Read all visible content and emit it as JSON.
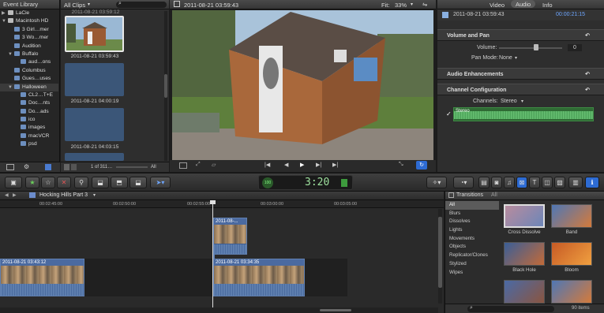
{
  "library": {
    "title": "Event Library",
    "items": [
      {
        "label": "LaCie",
        "kind": "drive",
        "indent": 0,
        "expanded": false
      },
      {
        "label": "Macintosh HD",
        "kind": "drive",
        "indent": 0,
        "expanded": true
      },
      {
        "label": "3 Girl…mer",
        "kind": "event",
        "indent": 1
      },
      {
        "label": "3 Wo…mer",
        "kind": "event",
        "indent": 1
      },
      {
        "label": "Audition",
        "kind": "event",
        "indent": 1
      },
      {
        "label": "Buffalo",
        "kind": "event",
        "indent": 1,
        "expanded": true
      },
      {
        "label": "aud…ons",
        "kind": "event",
        "indent": 2
      },
      {
        "label": "Columbus",
        "kind": "event",
        "indent": 1
      },
      {
        "label": "Gues…uses",
        "kind": "event",
        "indent": 1
      },
      {
        "label": "Halloween",
        "kind": "event",
        "indent": 1,
        "expanded": true
      },
      {
        "label": "CL2…T+E",
        "kind": "event",
        "indent": 2
      },
      {
        "label": "Doc…nts",
        "kind": "event",
        "indent": 2
      },
      {
        "label": "Do…ads",
        "kind": "event",
        "indent": 2
      },
      {
        "label": "ico",
        "kind": "event",
        "indent": 2
      },
      {
        "label": "images",
        "kind": "event",
        "indent": 2
      },
      {
        "label": "macVCR",
        "kind": "event",
        "indent": 2
      },
      {
        "label": "psd",
        "kind": "event",
        "indent": 2
      }
    ]
  },
  "browser": {
    "filter": "All Clips",
    "top_label": "2011-08-21 03:59:12",
    "clips": [
      {
        "label": "2011-08-21 03:59:43",
        "selected": true
      },
      {
        "label": "2011-08-21 04:00:19",
        "selected": false
      },
      {
        "label": "2011-08-21 04:03:15",
        "selected": false
      }
    ],
    "count": "1 of 311…",
    "zoom_label": "All"
  },
  "viewer": {
    "title": "2011-08-21 03:59:43",
    "fit_label": "Fit:",
    "fit_value": "33%"
  },
  "inspector": {
    "tabs": [
      "Video",
      "Audio",
      "Info"
    ],
    "active_tab": "Audio",
    "clip_name": "2011-08-21 03:59:43",
    "duration": "00:00:21:15",
    "volume_pan": "Volume and Pan",
    "volume_label": "Volume:",
    "volume_value": "0",
    "pan_mode_label": "Pan Mode:",
    "pan_mode_value": "None",
    "audio_enh": "Audio Enhancements",
    "channel_config": "Channel Configuration",
    "channels_label": "Channels:",
    "channels_value": "Stereo",
    "stereo_label": "Stereo"
  },
  "toolbar": {
    "timecode": "3:20",
    "timecode_prefix": "100"
  },
  "timeline": {
    "project": "Hocking Hills Part 3",
    "ruler": [
      "00:02:45:00",
      "00:02:50:00",
      "00:02:55:00",
      "00:03:00:00",
      "00:03:05:00"
    ],
    "clip_upper": "2011-08-...",
    "clip_left": "2011-08-21 03:43:12",
    "clip_right": "2011-08-21 03:34:35"
  },
  "transitions": {
    "title": "Transitions",
    "scope": "All",
    "categories": [
      "All",
      "Blurs",
      "Dissolves",
      "Lights",
      "Movements",
      "Objects",
      "Replicator/Clones",
      "Stylized",
      "Wipes"
    ],
    "selected_category": "All",
    "items": [
      {
        "label": "Cross Dissolve",
        "color1": "#b88c9e",
        "color2": "#6d86b8"
      },
      {
        "label": "Band",
        "color1": "#4f77b5",
        "color2": "#d47a3b"
      },
      {
        "label": "Black Hole",
        "color1": "#3a5e97",
        "color2": "#c26a38"
      },
      {
        "label": "Bloom",
        "color1": "#c65a25",
        "color2": "#f0a040"
      },
      {
        "label": "",
        "color1": "#4a6aa5",
        "color2": "#8a5540"
      },
      {
        "label": "",
        "color1": "#4f77b5",
        "color2": "#d47a3b"
      }
    ],
    "count": "90 items"
  }
}
